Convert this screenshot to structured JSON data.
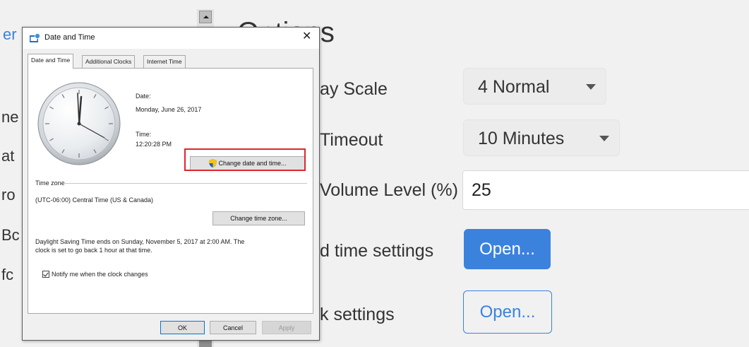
{
  "background": {
    "left_link": "er",
    "left_items": [
      "ne",
      "at",
      "ro",
      "Bc",
      "fc"
    ],
    "options_title": "Options",
    "display_scale": {
      "label": "ay Scale",
      "value": "4 Normal"
    },
    "timeout": {
      "label": "Timeout",
      "value": "10 Minutes"
    },
    "volume": {
      "label": "Volume Level (%)",
      "value": "25"
    },
    "time_settings": {
      "label": "d time settings",
      "button": "Open..."
    },
    "clock_settings": {
      "label": "k settings",
      "button": "Open..."
    },
    "colors": {
      "accent": "#3b82dd",
      "page_bg": "#f1f1f1"
    }
  },
  "dialog": {
    "title": "Date and Time",
    "close_glyph": "✕",
    "tabs": [
      "Date and Time",
      "Additional Clocks",
      "Internet Time"
    ],
    "date_label": "Date:",
    "date_value": "Monday, June 26, 2017",
    "time_label": "Time:",
    "time_value": "12:20:28 PM",
    "change_dt_button": "Change date and time...",
    "timezone_heading": "Time zone",
    "timezone_value": "(UTC-06:00) Central Time (US & Canada)",
    "change_tz_button": "Change time zone...",
    "dst_line1": "Daylight Saving Time ends on Sunday, November 5, 2017 at 2:00 AM. The",
    "dst_line2": "clock is set to go back 1 hour at that time.",
    "notify_label": "Notify me when the clock changes",
    "ok_button": "OK",
    "cancel_button": "Cancel",
    "apply_button": "Apply",
    "highlight_color": "#e0262c"
  }
}
